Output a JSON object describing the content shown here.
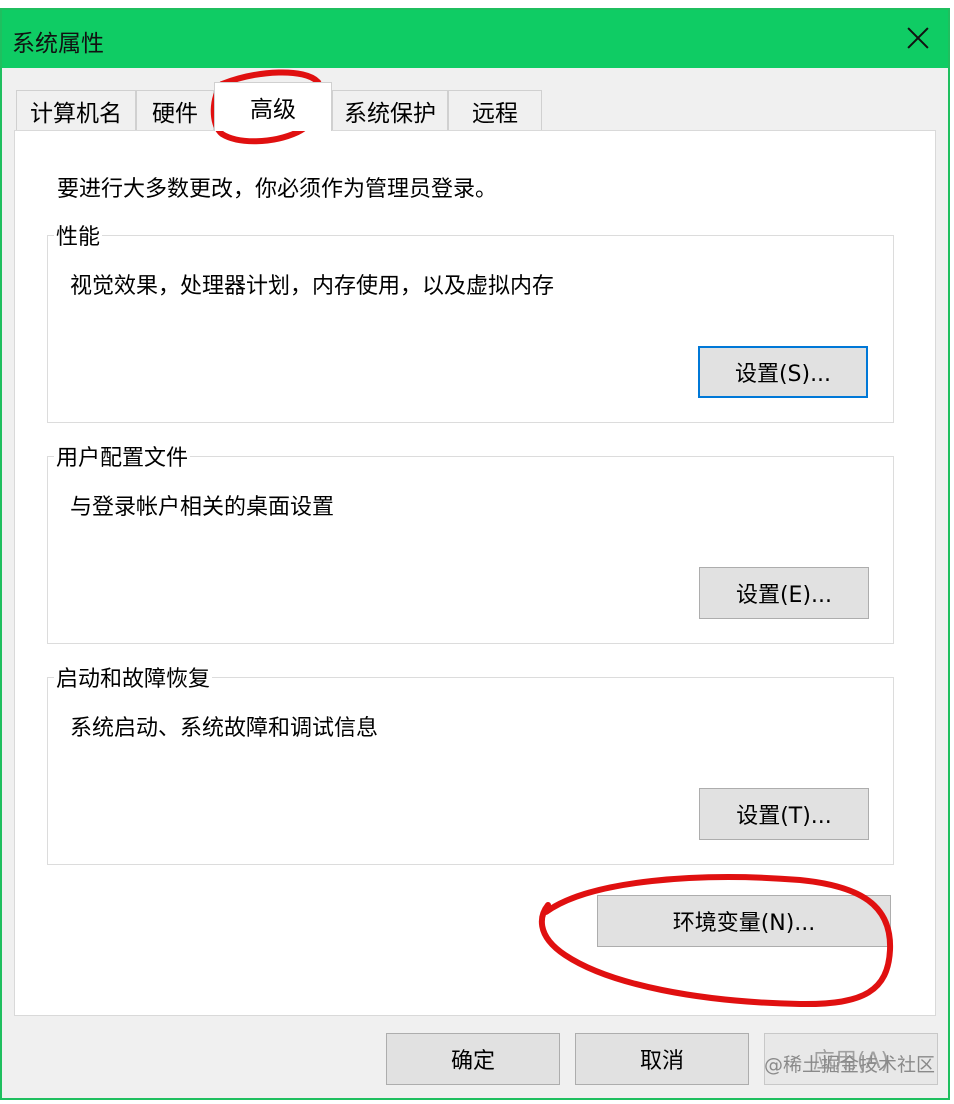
{
  "window": {
    "title": "系统属性"
  },
  "tabs": [
    {
      "label": "计算机名"
    },
    {
      "label": "硬件"
    },
    {
      "label": "高级"
    },
    {
      "label": "系统保护"
    },
    {
      "label": "远程"
    }
  ],
  "intro": "要进行大多数更改，你必须作为管理员登录。",
  "groups": {
    "performance": {
      "title": "性能",
      "desc": "视觉效果，处理器计划，内存使用，以及虚拟内存",
      "button": "设置(S)..."
    },
    "profiles": {
      "title": "用户配置文件",
      "desc": "与登录帐户相关的桌面设置",
      "button": "设置(E)..."
    },
    "startup": {
      "title": "启动和故障恢复",
      "desc": "系统启动、系统故障和调试信息",
      "button": "设置(T)..."
    }
  },
  "env_button": "环境变量(N)...",
  "footer": {
    "ok": "确定",
    "cancel": "取消",
    "apply": "应用(A)"
  },
  "watermark": "@稀土掘金技术社区",
  "colors": {
    "titlebar": "#0fcc64",
    "annotation": "#e01010",
    "focus": "#0078d7"
  }
}
